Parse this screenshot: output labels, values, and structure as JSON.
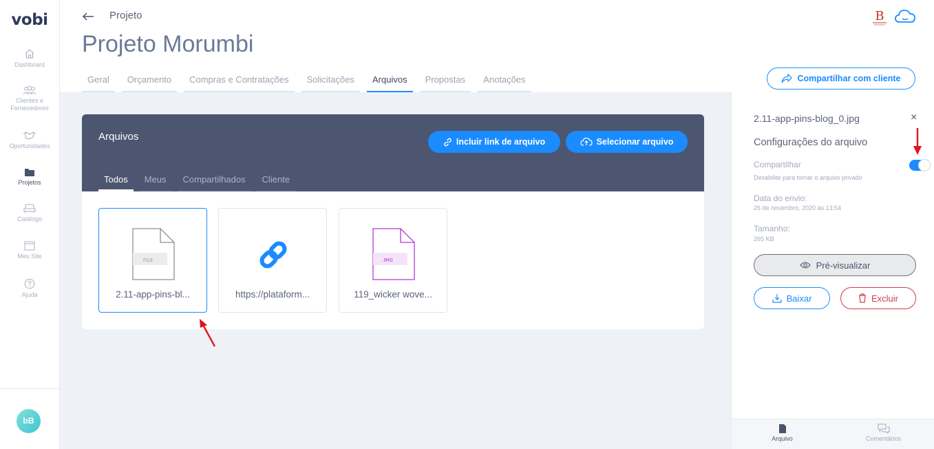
{
  "app": {
    "logo": "vobi"
  },
  "sidebar": {
    "items": [
      {
        "label": "Dashboard",
        "icon": "home-icon"
      },
      {
        "label": "Clientes e Fornecedores",
        "icon": "people-icon"
      },
      {
        "label": "Oportunidades",
        "icon": "handshake-icon"
      },
      {
        "label": "Projetos",
        "icon": "folder-icon",
        "active": true
      },
      {
        "label": "Catálogo",
        "icon": "sofa-icon"
      },
      {
        "label": "Meu Site",
        "icon": "browser-icon"
      },
      {
        "label": "Ajuda",
        "icon": "help-icon"
      }
    ],
    "avatar": "bB"
  },
  "header": {
    "breadcrumb": "Projeto",
    "title": "Projeto Morumbi",
    "tabs": [
      "Geral",
      "Orçamento",
      "Compras e Contratações",
      "Solicitações",
      "Arquivos",
      "Propostas",
      "Anotações"
    ],
    "active_tab": "Arquivos",
    "share_button": "Compartilhar com cliente"
  },
  "files_card": {
    "title": "Arquivos",
    "link_button": "Incluir link de arquivo",
    "select_button": "Selecionar arquivo",
    "tabs": [
      "Todos",
      "Meus",
      "Compartilhados",
      "Cliente"
    ],
    "active_tab": "Todos",
    "files": [
      {
        "name": "2.11-app-pins-bl...",
        "type_label": ".FILE",
        "kind": "file"
      },
      {
        "name": "https://plataform...",
        "kind": "link"
      },
      {
        "name": "119_wicker wove...",
        "type_label": ".IMG",
        "kind": "image"
      }
    ]
  },
  "panel": {
    "file_name": "2.11-app-pins-blog_0.jpg",
    "close": "×",
    "heading": "Configurações do arquivo",
    "share_label": "Compartilhar",
    "share_hint": "Desabilite para tornar o arquivo privado",
    "share_enabled": true,
    "sent_label": "Data do envio:",
    "sent_value": "26 de novembro, 2020 às 13:54",
    "size_label": "Tamanho:",
    "size_value": "265 KB",
    "preview_button": "Pré-visualizar",
    "download_button": "Baixar",
    "delete_button": "Excluir",
    "footer_tabs": [
      "Arquivo",
      "Comentários"
    ]
  },
  "colors": {
    "accent": "#1a8cff",
    "header_dark": "#4d5670",
    "danger": "#d33a4a",
    "annotation": "#e0141e"
  }
}
